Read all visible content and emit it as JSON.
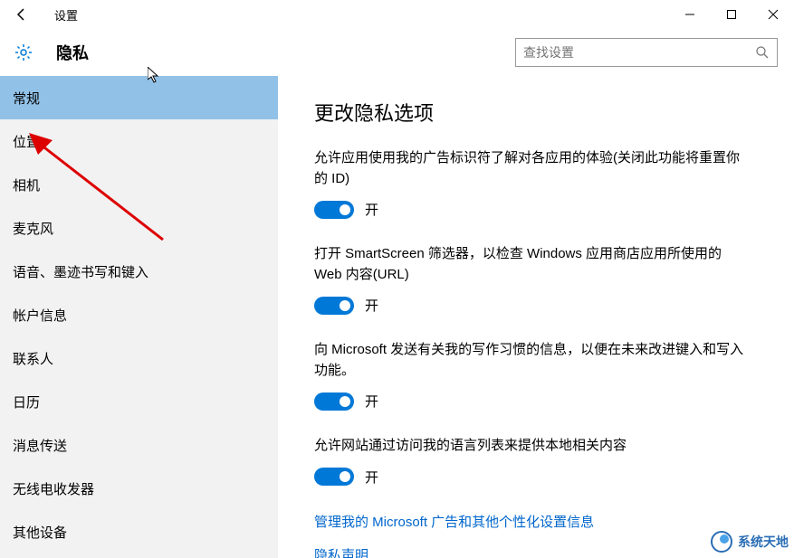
{
  "window": {
    "title": "设置"
  },
  "header": {
    "page_title": "隐私",
    "search_placeholder": "查找设置"
  },
  "sidebar": {
    "items": [
      {
        "label": "常规",
        "selected": true
      },
      {
        "label": "位置",
        "selected": false
      },
      {
        "label": "相机",
        "selected": false
      },
      {
        "label": "麦克风",
        "selected": false
      },
      {
        "label": "语音、墨迹书写和键入",
        "selected": false
      },
      {
        "label": "帐户信息",
        "selected": false
      },
      {
        "label": "联系人",
        "selected": false
      },
      {
        "label": "日历",
        "selected": false
      },
      {
        "label": "消息传送",
        "selected": false
      },
      {
        "label": "无线电收发器",
        "selected": false
      },
      {
        "label": "其他设备",
        "selected": false
      }
    ]
  },
  "main": {
    "heading": "更改隐私选项",
    "settings": [
      {
        "desc": "允许应用使用我的广告标识符了解对各应用的体验(关闭此功能将重置你的 ID)",
        "state_label": "开",
        "on": true
      },
      {
        "desc": "打开 SmartScreen 筛选器，以检查 Windows 应用商店应用所使用的 Web 内容(URL)",
        "state_label": "开",
        "on": true
      },
      {
        "desc": "向 Microsoft 发送有关我的写作习惯的信息，以便在未来改进键入和写入功能。",
        "state_label": "开",
        "on": true
      },
      {
        "desc": "允许网站通过访问我的语言列表来提供本地相关内容",
        "state_label": "开",
        "on": true
      }
    ],
    "links": [
      {
        "label": "管理我的 Microsoft 广告和其他个性化设置信息"
      },
      {
        "label": "隐私声明"
      }
    ]
  },
  "watermark": {
    "label": "系统天地"
  }
}
